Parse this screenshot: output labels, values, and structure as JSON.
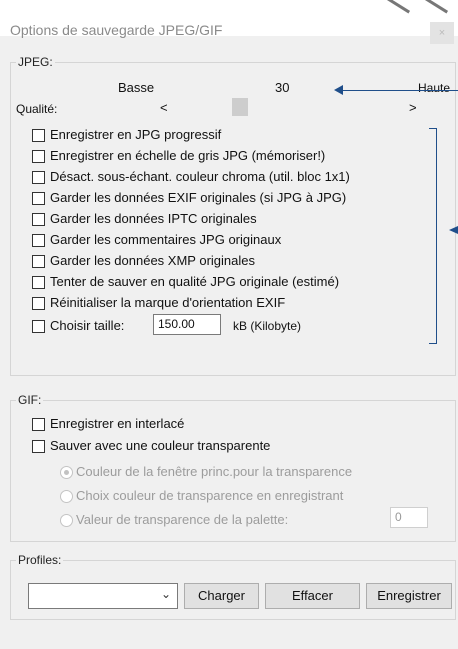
{
  "window": {
    "title": "Options de sauvegarde JPEG/GIF",
    "close_label": "×"
  },
  "jpeg": {
    "group_label": "JPEG:",
    "low_label": "Basse",
    "value": "30",
    "high_label": "Haute",
    "quality_label": "Qualité:",
    "left_arrow": "<",
    "right_arrow": ">",
    "options": [
      {
        "label": "Enregistrer en JPG progressif",
        "checked": false
      },
      {
        "label": "Enregistrer en échelle de gris JPG (mémoriser!)",
        "checked": false
      },
      {
        "label": "Désact. sous-échant. couleur chroma (util. bloc 1x1)",
        "checked": false
      },
      {
        "label": "Garder les données EXIF originales (si JPG à JPG)",
        "checked": false
      },
      {
        "label": "Garder les données IPTC originales",
        "checked": false
      },
      {
        "label": "Garder les commentaires JPG originaux",
        "checked": false
      },
      {
        "label": "Garder les données XMP originales",
        "checked": false
      },
      {
        "label": "Tenter de sauver en qualité JPG originale (estimé)",
        "checked": false
      },
      {
        "label": "Réinitialiser la marque d'orientation EXIF",
        "checked": false
      }
    ],
    "size_label": "Choisir taille:",
    "size_value": "150.00",
    "size_unit": "kB (Kilobyte)"
  },
  "gif": {
    "group_label": "GIF:",
    "interlaced_label": "Enregistrer en interlacé",
    "transparent_label": "Sauver avec une couleur transparente",
    "radio1": "Couleur de la fenêtre princ.pour la transparence",
    "radio2": "Choix couleur de transparence en enregistrant",
    "radio3": "Valeur de transparence de la palette:",
    "palette_value": "0"
  },
  "profiles": {
    "label": "Profiles:",
    "load_button": "Charger",
    "delete_button": "Effacer",
    "save_button": "Enregistrer"
  }
}
